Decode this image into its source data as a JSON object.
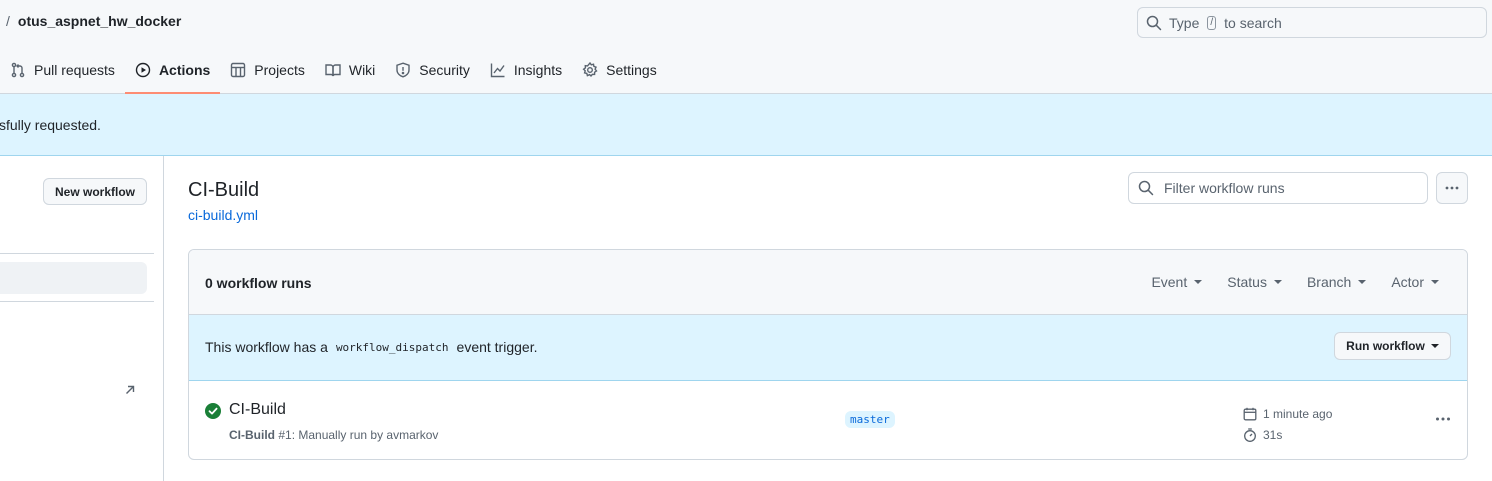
{
  "header": {
    "separator": "/",
    "repo_name": "otus_aspnet_hw_docker",
    "search": {
      "prefix": "Type",
      "key": "/",
      "suffix": "to search"
    },
    "tabs": [
      {
        "label": "Pull requests",
        "icon": "git-pull-request-icon"
      },
      {
        "label": "Actions",
        "icon": "play-circle-icon",
        "selected": true
      },
      {
        "label": "Projects",
        "icon": "table-icon"
      },
      {
        "label": "Wiki",
        "icon": "book-icon"
      },
      {
        "label": "Security",
        "icon": "shield-icon"
      },
      {
        "label": "Insights",
        "icon": "graph-icon"
      },
      {
        "label": "Settings",
        "icon": "gear-icon"
      }
    ]
  },
  "flash": {
    "message": "sfully requested."
  },
  "sidebar": {
    "new_workflow_label": "New workflow"
  },
  "workflow": {
    "title": "CI-Build",
    "file": "ci-build.yml",
    "filter_placeholder": "Filter workflow runs"
  },
  "runs_box": {
    "count_label": "0 workflow runs",
    "filters": [
      "Event",
      "Status",
      "Branch",
      "Actor"
    ],
    "dispatch": {
      "text_before": "This workflow has a",
      "code": "workflow_dispatch",
      "text_after": "event trigger.",
      "button_label": "Run workflow"
    },
    "runs": [
      {
        "title": "CI-Build",
        "sub_workflow": "CI-Build",
        "sub_detail": "#1: Manually run by avmarkov",
        "branch": "master",
        "time": "1 minute ago",
        "duration": "31s",
        "status": "success"
      }
    ]
  },
  "colors": {
    "accent": "#0969da",
    "success": "#1a7f37",
    "tab_underline": "#fd8c73",
    "flash_bg": "#ddf4ff"
  }
}
